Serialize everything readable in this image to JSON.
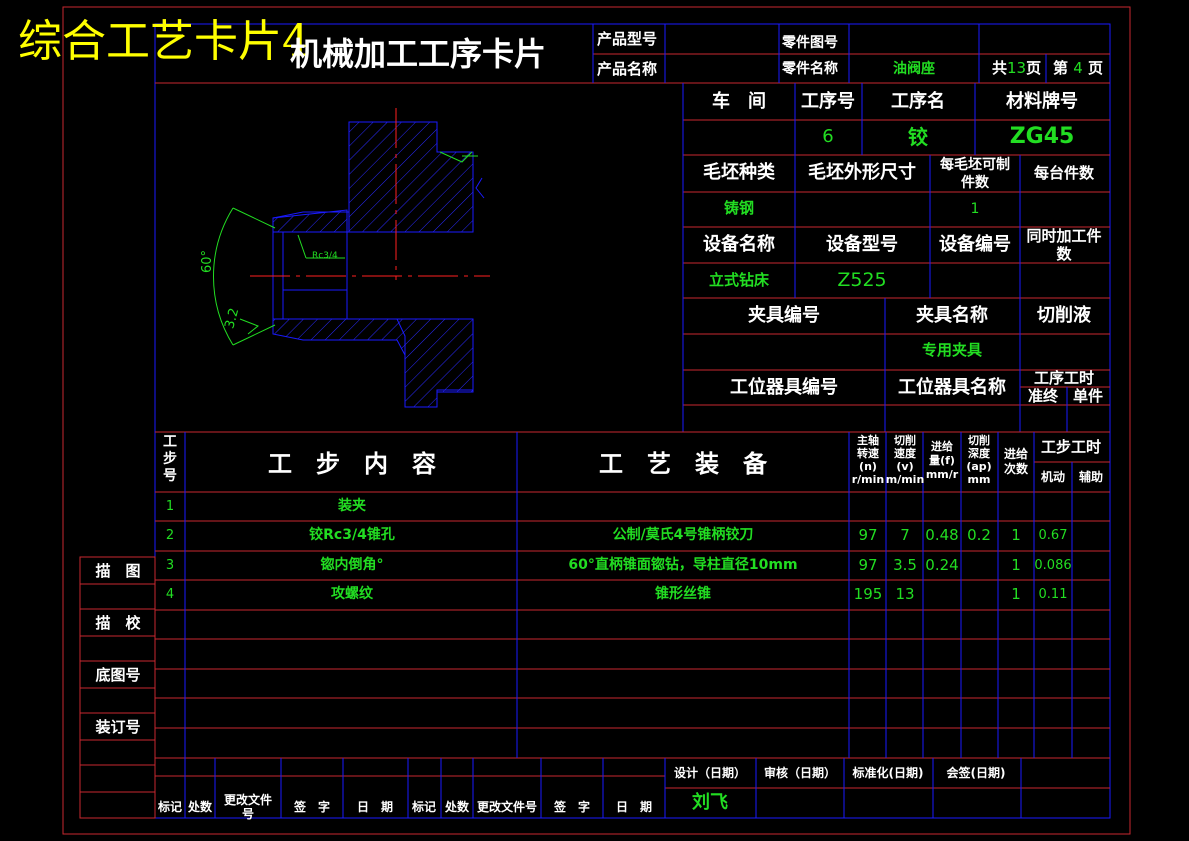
{
  "banner": "综合工艺卡片4",
  "card_title": "机械加工工序卡片",
  "header": {
    "product_model_label": "产品型号",
    "product_name_label": "产品名称",
    "part_drawing_label": "零件图号",
    "part_name_label": "零件名称",
    "part_name": "油阀座",
    "total_pages_prefix": "共",
    "total_pages": "13",
    "total_pages_suffix": "页",
    "page_prefix": "第",
    "page_no": "4",
    "page_suffix": "页"
  },
  "info": {
    "workshop_label": "车　间",
    "op_no_label": "工序号",
    "op_name_label": "工序名",
    "material_label": "材料牌号",
    "op_no": "6",
    "op_name": "铰",
    "material": "ZG45",
    "blank_type_label": "毛坯种类",
    "blank_size_label": "毛坯外形尺寸",
    "per_blank_label_1": "每毛坯可制",
    "per_blank_label_2": "件数",
    "per_unit_label": "每台件数",
    "blank_type": "铸钢",
    "per_blank": "1",
    "equip_name_label": "设备名称",
    "equip_model_label": "设备型号",
    "equip_no_label": "设备编号",
    "simul_label_1": "同时加工件",
    "simul_label_2": "数",
    "equip_name": "立式钻床",
    "equip_model": "Z525",
    "fixture_no_label": "夹具编号",
    "fixture_name_label": "夹具名称",
    "coolant_label": "切削液",
    "fixture_name": "专用夹具",
    "station_no_label": "工位器具编号",
    "station_name_label": "工位器具名称",
    "op_time_label": "工序工时",
    "prep_label": "准终",
    "unit_label": "单件"
  },
  "drawing": {
    "angle_label": "60°",
    "thread_label": "Rc3/4",
    "rough_label": "3.2"
  },
  "steps_header": {
    "step_no_1": "工",
    "step_no_2": "步",
    "step_no_3": "号",
    "content": "工　步　内　容",
    "equipment": "工　艺　装　备",
    "spindle_1": "主轴",
    "spindle_2": "转速",
    "spindle_3": "(n)",
    "spindle_4": "r/min",
    "speed_1": "切削",
    "speed_2": "速度",
    "speed_3": "(v)",
    "speed_4": "m/min",
    "feed_1": "进给",
    "feed_2": "量(f)",
    "feed_3": "mm/r",
    "depth_1": "切削",
    "depth_2": "深度",
    "depth_3": "(ap)",
    "depth_4": "mm",
    "passes_1": "进给",
    "passes_2": "次数",
    "time": "工步工时",
    "machine": "机动",
    "aux": "辅助"
  },
  "steps": [
    {
      "no": "1",
      "content": "装夹",
      "equip": "",
      "n": "",
      "v": "",
      "f": "",
      "ap": "",
      "passes": "",
      "machine": ""
    },
    {
      "no": "2",
      "content": "铰Rc3/4锥孔",
      "equip": "公制/莫氏4号锥柄铰刀",
      "n": "97",
      "v": "7",
      "f": "0.48",
      "ap": "0.2",
      "passes": "1",
      "machine": "0.67"
    },
    {
      "no": "3",
      "content": "锪内倒角°",
      "equip": "60°直柄锥面锪钻，导柱直径10mm",
      "n": "97",
      "v": "3.5",
      "f": "0.24",
      "ap": "",
      "passes": "1",
      "machine": "0.086"
    },
    {
      "no": "4",
      "content": "攻螺纹",
      "equip": "锥形丝锥",
      "n": "195",
      "v": "13",
      "f": "",
      "ap": "",
      "passes": "1",
      "machine": "0.11"
    }
  ],
  "side": {
    "draw": "描　图",
    "check": "描　校",
    "base_no": "底图号",
    "bind_no": "装订号"
  },
  "footer": {
    "mark": "标记",
    "count": "处数",
    "change_doc_1": "更改文件",
    "change_doc_2": "号",
    "sign": "签　字",
    "date": "日　期",
    "mark2": "标记",
    "count2": "处数",
    "change_doc2": "更改文件号",
    "sign2": "签　字",
    "date2": "日　期",
    "design": "设计（日期）",
    "review": "审核（日期）",
    "standard": "标准化(日期)",
    "countersign": "会签(日期)",
    "designer": "刘飞"
  }
}
